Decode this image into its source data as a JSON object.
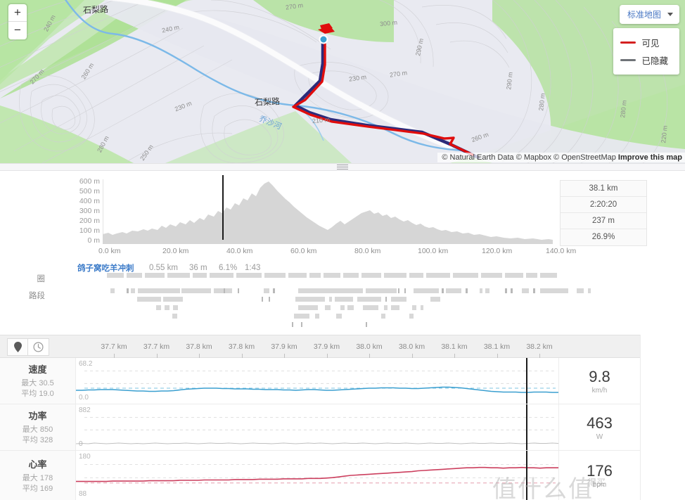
{
  "map": {
    "zoom_in": "+",
    "zoom_out": "−",
    "maptype_label": "标准地图",
    "legend": [
      {
        "label": "可见",
        "color": "#d42020"
      },
      {
        "label": "已隐藏",
        "color": "#6f7378"
      }
    ],
    "attribution": "© Natural Earth Data © Mapbox © OpenStreetMap",
    "attribution_link": "Improve this map",
    "road_labels": [
      "石梨路",
      "石梨路"
    ],
    "river_label": "乔沙河",
    "contour_labels": [
      "240 m",
      "270 m",
      "260 m",
      "230 m",
      "280 m",
      "240 m",
      "270 m",
      "210 m",
      "230 m",
      "270 m",
      "290 m",
      "300 m",
      "260 m",
      "290 m",
      "280 m",
      "280 m",
      "220 m",
      "250 m"
    ]
  },
  "elevation": {
    "y_ticks": [
      "600 m",
      "500 m",
      "400 m",
      "300 m",
      "200 m",
      "100 m",
      "0 m"
    ],
    "x_ticks": [
      "0.0 km",
      "20.0 km",
      "40.0 km",
      "60.0 km",
      "80.0 km",
      "100.0 km",
      "120.0 km",
      "140.0 km"
    ],
    "stats": [
      "38.1 km",
      "2:20:20",
      "237 m",
      "26.9%"
    ]
  },
  "segment": {
    "name": "鸽子窝吃羊冲刺",
    "distance": "0.55 km",
    "elevation": "36 m",
    "grade": "6.1%",
    "time": "1:43"
  },
  "laps_section": {
    "lap_label": "圈",
    "segment_label": "路段"
  },
  "axis": {
    "pin_icon": "map-pin-icon",
    "clock_icon": "clock-icon",
    "ticks": [
      "37.7 km",
      "37.7 km",
      "37.8 km",
      "37.8 km",
      "37.9 km",
      "37.9 km",
      "38.0 km",
      "38.0 km",
      "38.1 km",
      "38.1 km",
      "38.2 km"
    ]
  },
  "charts": [
    {
      "name": "速度",
      "max_label": "最大 30.5",
      "avg_label": "平均 19.0",
      "y_max": "68.2",
      "y_min": "0.0",
      "value": "9.8",
      "unit": "km/h",
      "color": "#3a9fd0",
      "series": [
        0.24,
        0.24,
        0.25,
        0.25,
        0.26,
        0.26,
        0.26,
        0.25,
        0.24,
        0.23,
        0.22,
        0.22,
        0.21,
        0.21,
        0.22,
        0.22,
        0.23,
        0.25,
        0.27,
        0.28,
        0.29,
        0.3,
        0.3,
        0.3,
        0.29,
        0.29,
        0.28,
        0.28,
        0.28,
        0.27,
        0.27,
        0.26,
        0.26,
        0.26,
        0.25,
        0.25,
        0.24,
        0.25,
        0.26,
        0.26,
        0.25,
        0.24,
        0.24,
        0.25,
        0.26,
        0.27,
        0.28,
        0.29,
        0.3,
        0.3,
        0.31,
        0.31,
        0.31,
        0.3,
        0.3,
        0.29,
        0.29,
        0.3,
        0.31,
        0.32,
        0.33,
        0.33,
        0.32,
        0.31,
        0.29,
        0.27,
        0.25,
        0.23,
        0.21,
        0.2,
        0.19,
        0.19,
        0.19,
        0.18,
        0.18,
        0.19,
        0.19,
        0.19,
        0.18,
        0.18
      ]
    },
    {
      "name": "功率",
      "max_label": "最大 850",
      "avg_label": "平均 328",
      "y_max": "882",
      "y_min": "0",
      "value": "463",
      "unit": "W",
      "color": "#c0c0c0",
      "series": [
        0.04,
        0.05,
        0.04,
        0.06,
        0.05,
        0.04,
        0.05,
        0.06,
        0.05,
        0.04,
        0.05,
        0.04,
        0.05,
        0.06,
        0.05,
        0.04,
        0.05,
        0.05,
        0.06,
        0.05,
        0.04,
        0.05,
        0.06,
        0.05,
        0.05,
        0.06,
        0.05,
        0.04,
        0.05,
        0.06,
        0.05,
        0.05,
        0.04,
        0.05,
        0.06,
        0.05,
        0.04,
        0.05,
        0.06,
        0.05,
        0.06,
        0.05,
        0.04,
        0.05,
        0.06,
        0.05,
        0.05,
        0.06,
        0.05,
        0.04,
        0.05,
        0.06,
        0.05,
        0.05,
        0.06,
        0.05,
        0.04,
        0.05,
        0.06,
        0.05,
        0.05,
        0.06,
        0.05,
        0.04,
        0.05,
        0.06,
        0.05,
        0.05,
        0.06,
        0.05,
        0.05,
        0.06,
        0.05,
        0.04,
        0.05,
        0.06,
        0.05,
        0.05,
        0.06,
        0.05
      ]
    },
    {
      "name": "心率",
      "max_label": "最大 178",
      "avg_label": "平均 169",
      "y_max": "180",
      "y_min": "88",
      "value": "176",
      "unit": "bpm",
      "color": "#cc3f5e",
      "series": [
        0.34,
        0.34,
        0.34,
        0.34,
        0.34,
        0.34,
        0.35,
        0.35,
        0.35,
        0.35,
        0.35,
        0.35,
        0.36,
        0.36,
        0.36,
        0.36,
        0.36,
        0.37,
        0.37,
        0.37,
        0.37,
        0.38,
        0.38,
        0.38,
        0.38,
        0.38,
        0.39,
        0.39,
        0.39,
        0.39,
        0.4,
        0.4,
        0.4,
        0.4,
        0.41,
        0.41,
        0.41,
        0.41,
        0.42,
        0.42,
        0.42,
        0.43,
        0.44,
        0.46,
        0.48,
        0.5,
        0.51,
        0.52,
        0.53,
        0.54,
        0.55,
        0.56,
        0.57,
        0.58,
        0.59,
        0.6,
        0.62,
        0.63,
        0.64,
        0.65,
        0.66,
        0.67,
        0.68,
        0.69,
        0.7,
        0.7,
        0.71,
        0.71,
        0.7,
        0.7,
        0.69,
        0.7,
        0.7,
        0.71,
        0.7,
        0.7,
        0.69,
        0.7,
        0.7,
        0.7
      ]
    }
  ],
  "watermark": {
    "big": "值什么值",
    "small": "得买"
  }
}
